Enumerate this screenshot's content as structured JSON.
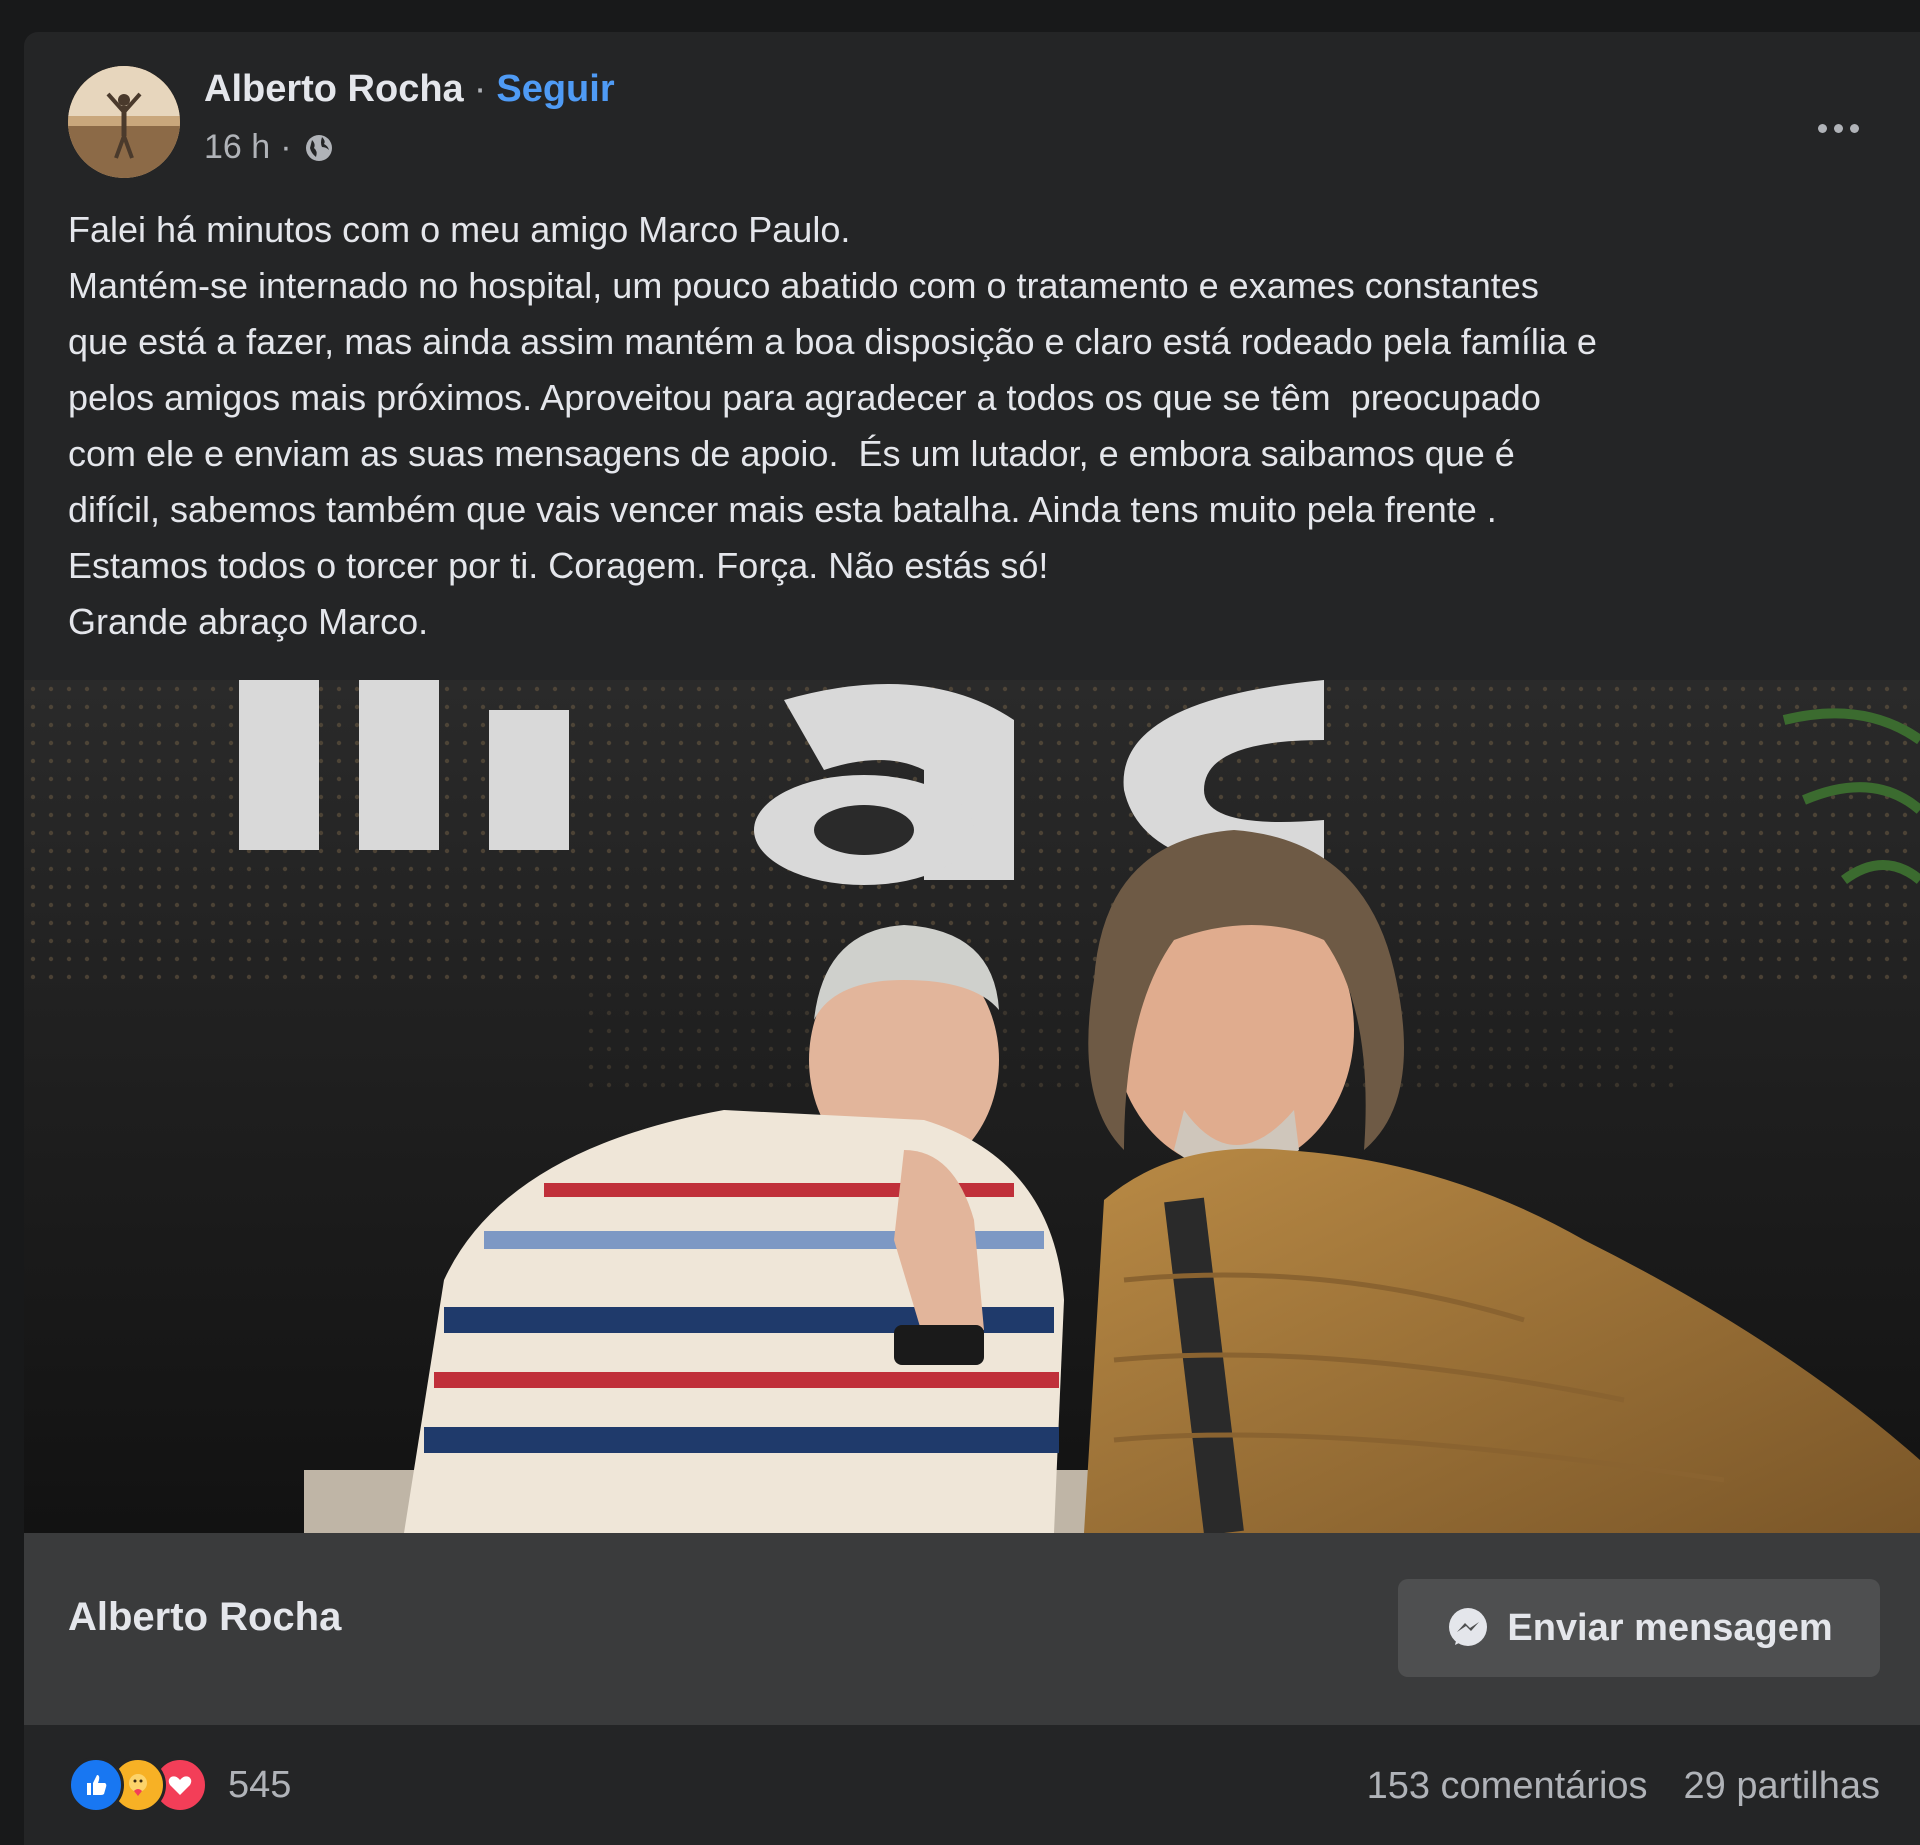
{
  "post": {
    "author": "Alberto Rocha",
    "separator": "·",
    "follow_label": "Seguir",
    "time": "16 h",
    "time_separator": "·",
    "audience_icon": "globe-icon",
    "more_icon": "more-options-icon",
    "text_lines": [
      "Falei há minutos com o meu amigo Marco Paulo.",
      "Mantém-se internado no hospital, um pouco abatido com o tratamento e exames constantes",
      "que está a fazer, mas ainda assim mantém a boa disposição e claro está rodeado pela família e",
      "pelos amigos mais próximos. Aproveitou para agradecer a todos os que se têm  preocupado",
      "com ele e enviam as suas mensagens de apoio.  És um lutador, e embora saibamos que é",
      "difícil, sabemos também que vais vencer mais esta batalha. Ainda tens muito pela frente .",
      "Estamos todos o torcer por ti. Coragem. Força. Não estás só!",
      "Grande abraço Marco."
    ],
    "photo_sign_text": "fnac"
  },
  "card": {
    "name": "Alberto Rocha",
    "button_label": "Enviar mensagem",
    "button_icon": "messenger-icon"
  },
  "footer": {
    "reactions": [
      "like-icon",
      "care-icon",
      "love-icon"
    ],
    "reaction_count": "545",
    "comments": "153 comentários",
    "shares": "29 partilhas"
  },
  "colors": {
    "background": "#18191a",
    "card": "#242526",
    "text": "#e4e6eb",
    "secondary_text": "#b0b3b8",
    "link": "#4f9bf5",
    "like": "#1877f2",
    "care": "#f7b125",
    "love": "#f33e58"
  }
}
